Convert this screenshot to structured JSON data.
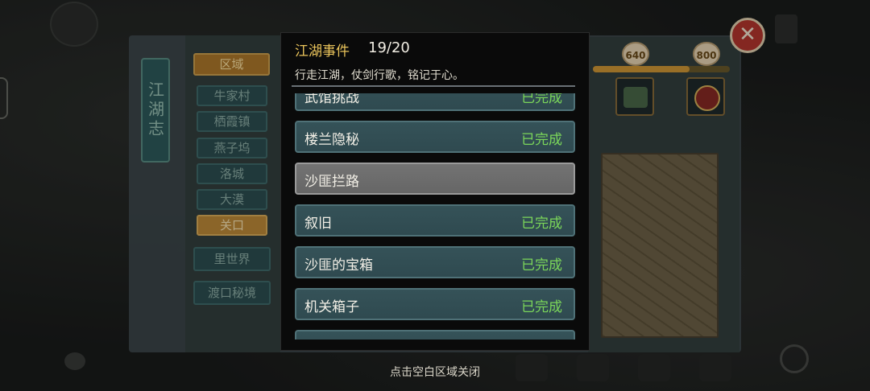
{
  "background": {
    "bg_text_top": "",
    "journal_spine": "江湖志",
    "region_header": "区域",
    "regions": [
      {
        "label": "牛家村",
        "active": false
      },
      {
        "label": "栖霞镇",
        "active": false
      },
      {
        "label": "燕子坞",
        "active": false
      },
      {
        "label": "洛城",
        "active": false
      },
      {
        "label": "大漠",
        "active": false
      },
      {
        "label": "关口",
        "active": true
      }
    ],
    "extra_regions": [
      "里世界",
      "渡口秘境"
    ],
    "milestones": [
      "640",
      "800"
    ],
    "close_symbol": "✕"
  },
  "modal": {
    "title": "江湖事件",
    "count": "19/20",
    "description": "行走江湖，仗剑行歌，铭记于心。",
    "events": [
      {
        "name": "武馆挑战",
        "status": "已完成"
      },
      {
        "name": "楼兰隐秘",
        "status": "已完成"
      },
      {
        "name": "沙匪拦路",
        "status": ""
      },
      {
        "name": "叙旧",
        "status": "已完成"
      },
      {
        "name": "沙匪的宝箱",
        "status": "已完成"
      },
      {
        "name": "机关箱子",
        "status": "已完成"
      },
      {
        "name": "",
        "status": ""
      }
    ]
  },
  "close_hint": "点击空白区域关闭",
  "colors": {
    "accent_gold": "#e9c35b",
    "completed_green": "#7bd65a",
    "row_teal": "#355258",
    "row_pending": "#737373"
  }
}
